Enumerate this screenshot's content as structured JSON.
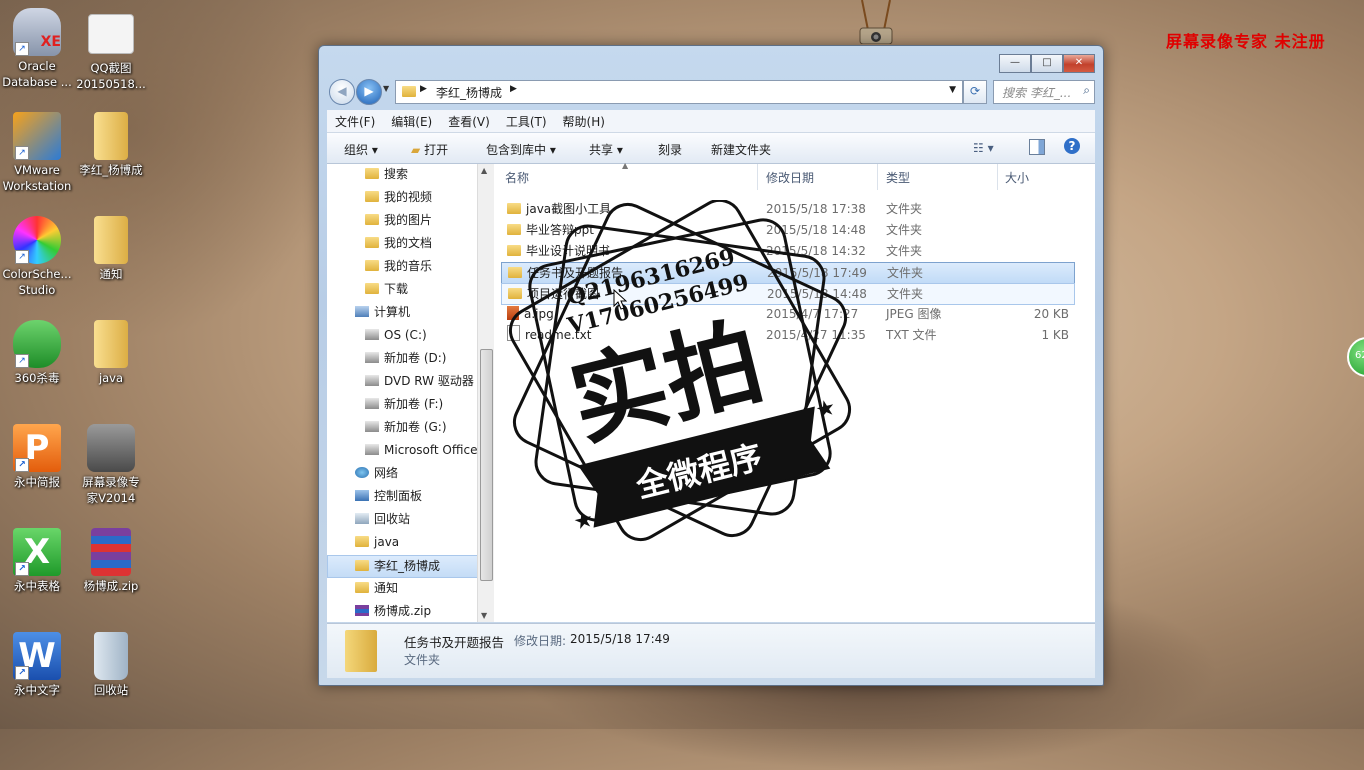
{
  "desktop": {
    "icons": [
      {
        "label1": "Oracle",
        "label2": "Database ..."
      },
      {
        "label1": "QQ截图",
        "label2": "20150518..."
      },
      {
        "label1": "VMware",
        "label2": "Workstation"
      },
      {
        "label1": "李红_杨博成",
        "label2": ""
      },
      {
        "label1": "ColorSche...",
        "label2": "Studio"
      },
      {
        "label1": "通知",
        "label2": ""
      },
      {
        "label1": "360杀毒",
        "label2": ""
      },
      {
        "label1": "java",
        "label2": ""
      },
      {
        "label1": "永中简报",
        "label2": ""
      },
      {
        "label1": "屏幕录像专",
        "label2": "家V2014"
      },
      {
        "label1": "永中表格",
        "label2": ""
      },
      {
        "label1": "杨博成.zip",
        "label2": ""
      },
      {
        "label1": "永中文字",
        "label2": ""
      },
      {
        "label1": "回收站",
        "label2": ""
      }
    ],
    "recorder_watermark": "屏幕录像专家  未注册",
    "badge_text": "62"
  },
  "window": {
    "buttons": {
      "minimize": "—",
      "maximize": "□",
      "close": "✕"
    },
    "address": {
      "crumbs": [
        "李红_杨博成"
      ]
    },
    "search_placeholder": "搜索 李红_...",
    "menu": [
      "文件(F)",
      "编辑(E)",
      "查看(V)",
      "工具(T)",
      "帮助(H)"
    ],
    "toolbar": {
      "organize": "组织",
      "open": "打开",
      "include": "包含到库中",
      "share": "共享",
      "burn": "刻录",
      "new_folder": "新建文件夹"
    },
    "nav": [
      {
        "label": "搜索",
        "type": "folder"
      },
      {
        "label": "我的视频",
        "type": "folder"
      },
      {
        "label": "我的图片",
        "type": "folder"
      },
      {
        "label": "我的文档",
        "type": "folder"
      },
      {
        "label": "我的音乐",
        "type": "folder"
      },
      {
        "label": "下载",
        "type": "folder"
      },
      {
        "label": "计算机",
        "type": "computer"
      },
      {
        "label": "OS (C:)",
        "type": "drive"
      },
      {
        "label": "新加卷 (D:)",
        "type": "drive"
      },
      {
        "label": "DVD RW 驱动器",
        "type": "drive"
      },
      {
        "label": "新加卷 (F:)",
        "type": "drive"
      },
      {
        "label": "新加卷 (G:)",
        "type": "drive"
      },
      {
        "label": "Microsoft Office",
        "type": "drive"
      },
      {
        "label": "网络",
        "type": "network"
      },
      {
        "label": "控制面板",
        "type": "panel"
      },
      {
        "label": "回收站",
        "type": "bin"
      },
      {
        "label": "java",
        "type": "folder"
      },
      {
        "label": "李红_杨博成",
        "type": "folder"
      },
      {
        "label": "通知",
        "type": "folder"
      },
      {
        "label": "杨博成.zip",
        "type": "zip"
      }
    ],
    "columns": {
      "name": "名称",
      "date": "修改日期",
      "type": "类型",
      "size": "大小"
    },
    "files": [
      {
        "name": "java截图小工具",
        "date": "2015/5/18 17:38",
        "type": "文件夹",
        "size": "",
        "kind": "folder"
      },
      {
        "name": "毕业答辩ppt",
        "date": "2015/5/18 14:48",
        "type": "文件夹",
        "size": "",
        "kind": "folder"
      },
      {
        "name": "毕业设计说明书",
        "date": "2015/5/18 14:32",
        "type": "文件夹",
        "size": "",
        "kind": "folder"
      },
      {
        "name": "任务书及开题报告",
        "date": "2015/5/18 17:49",
        "type": "文件夹",
        "size": "",
        "kind": "folder"
      },
      {
        "name": "项目运行截图",
        "date": "2015/5/18 14:48",
        "type": "文件夹",
        "size": "",
        "kind": "folder"
      },
      {
        "name": "a.jpg",
        "date": "2015/4/7 17:27",
        "type": "JPEG 图像",
        "size": "20 KB",
        "kind": "jpg"
      },
      {
        "name": "readme.txt",
        "date": "2015/4/27 11:35",
        "type": "TXT 文件",
        "size": "1 KB",
        "kind": "txt"
      }
    ],
    "details": {
      "name": "任务书及开题报告",
      "date_label": "修改日期:",
      "date": "2015/5/18 17:49",
      "type": "文件夹"
    }
  },
  "stamp": {
    "line1": "Q2196316269",
    "line2": "V17060256499",
    "main": "实拍",
    "banner": "全微程序"
  }
}
